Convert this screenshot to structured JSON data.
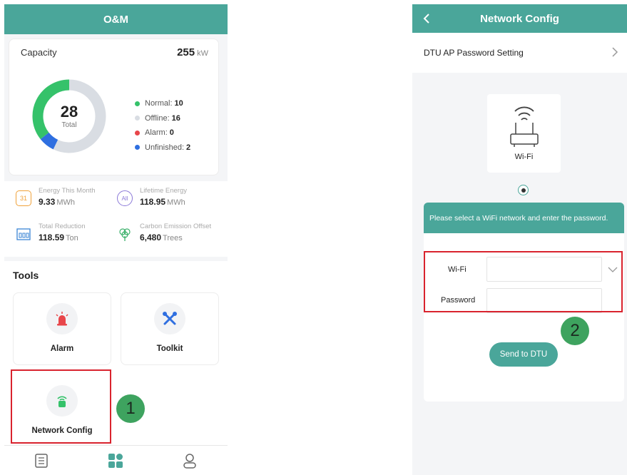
{
  "left": {
    "title": "O&M",
    "capacity": {
      "label": "Capacity",
      "value": "255",
      "unit": "kW",
      "total": "28",
      "total_label": "Total",
      "legend": [
        {
          "name": "Normal:",
          "value": "10",
          "color": "#35c26a"
        },
        {
          "name": "Offline:",
          "value": "16",
          "color": "#d9dde3"
        },
        {
          "name": "Alarm:",
          "value": "0",
          "color": "#e8464a"
        },
        {
          "name": "Unfinished:",
          "value": "2",
          "color": "#2f6fe0"
        }
      ]
    },
    "stats": [
      {
        "label": "Energy This Month",
        "value": "9.33",
        "unit": "MWh",
        "icon": "calendar-icon",
        "day": "31"
      },
      {
        "label": "Lifetime Energy",
        "value": "118.95",
        "unit": "MWh",
        "icon": "all-icon",
        "badge": "All"
      },
      {
        "label": "Total Reduction",
        "value": "118.59",
        "unit": "Ton",
        "icon": "factory-icon"
      },
      {
        "label": "Carbon Emission Offset",
        "value": "6,480",
        "unit": "Trees",
        "icon": "tree-icon"
      }
    ],
    "tools": {
      "title": "Tools",
      "items": [
        {
          "label": "Alarm",
          "icon": "alarm-icon"
        },
        {
          "label": "Toolkit",
          "icon": "toolkit-icon"
        },
        {
          "label": "Network Config",
          "icon": "network-config-icon"
        }
      ]
    },
    "tabs": [
      "report-icon",
      "apps-icon",
      "user-icon"
    ]
  },
  "right": {
    "title": "Network Config",
    "password_setting": "DTU AP Password Setting",
    "wifi_option": "Wi-Fi",
    "instruction": "Please select a WiFi network and enter the password.",
    "wifi_label": "Wi-Fi",
    "wifi_value": "",
    "password_label": "Password",
    "password_value": "",
    "send_button": "Send to DTU"
  },
  "steps": [
    "1",
    "2"
  ],
  "accent": "#4aa69a",
  "highlight": "#d9232e"
}
